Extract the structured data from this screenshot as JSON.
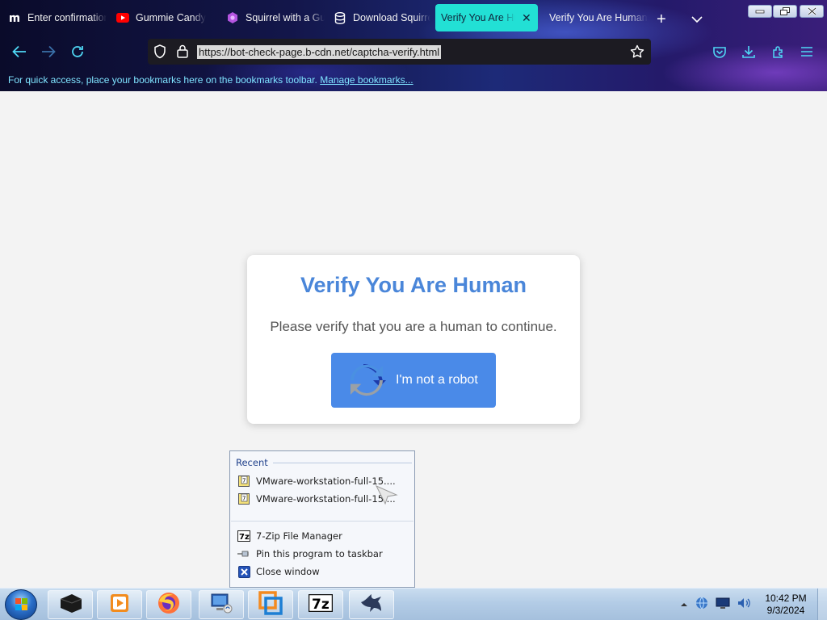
{
  "browser": {
    "tabs": [
      {
        "title": "Enter confirmation",
        "icon": "m-logo-icon",
        "active": false
      },
      {
        "title": "Gummie Candy",
        "icon": "youtube-icon",
        "active": false
      },
      {
        "title": "Squirrel with a Gun",
        "icon": "game-icon",
        "active": false
      },
      {
        "title": "Download Squirrel",
        "icon": "database-icon",
        "active": false
      },
      {
        "title": "Verify You Are Human",
        "icon": "",
        "active": true
      },
      {
        "title": "Verify You Are Human",
        "icon": "",
        "active": false
      }
    ],
    "url": "https://bot-check-page.b-cdn.net/captcha-verify.html",
    "bookmarks_text": "For quick access, place your bookmarks here on the bookmarks toolbar.",
    "bookmarks_link": "Manage bookmarks..."
  },
  "page": {
    "title": "Verify You Are Human",
    "message": "Please verify that you are a human to continue.",
    "button_label": "I'm not a robot",
    "accent_color": "#4a86d9",
    "button_color": "#4a8ae8"
  },
  "jumplist": {
    "recent_header": "Recent",
    "recent_items": [
      "VMware-workstation-full-15....",
      "VMware-workstation-full-15...."
    ],
    "tasks": [
      {
        "label": "7-Zip File Manager",
        "icon": "7zip-icon"
      },
      {
        "label": "Pin this program to taskbar",
        "icon": "pin-icon"
      },
      {
        "label": "Close window",
        "icon": "close-window-icon"
      }
    ]
  },
  "taskbar": {
    "clock_time": "10:42 PM",
    "clock_date": "9/3/2024",
    "pinned": [
      "terminal-icon",
      "media-player-icon",
      "firefox-icon",
      "computer-icon",
      "vmware-icon",
      "7zip-icon",
      "eagle-icon"
    ]
  }
}
